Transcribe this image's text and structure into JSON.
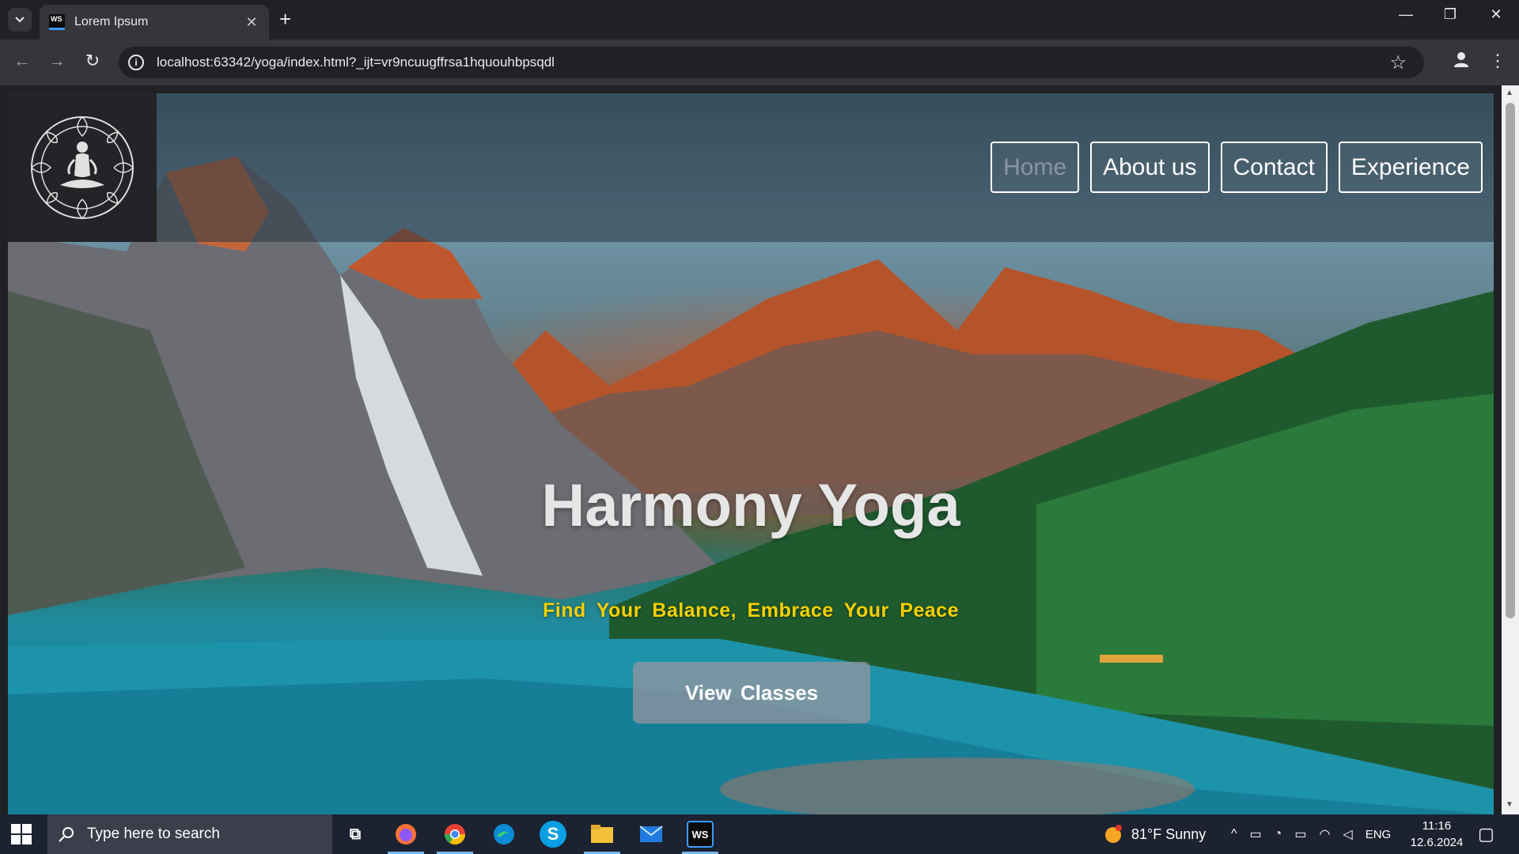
{
  "browser": {
    "tab_title": "Lorem Ipsum",
    "tab_favicon": "WS",
    "url": "localhost:63342/yoga/index.html?_ijt=vr9ncuugffrsa1hquouhbpsqdl",
    "icons": [
      "tab-search-icon",
      "close-icon",
      "new-tab-icon",
      "minimize-icon",
      "restore-icon",
      "window-close-icon",
      "back-icon",
      "forward-icon",
      "reload-icon",
      "site-info-icon",
      "bookmark-star-icon",
      "profile-icon",
      "menu-icon"
    ]
  },
  "page": {
    "logo": "lotus-meditation-logo",
    "nav": [
      {
        "label": "Home",
        "active": true
      },
      {
        "label": "About us",
        "active": false
      },
      {
        "label": "Contact",
        "active": false
      },
      {
        "label": "Experience",
        "active": false
      }
    ],
    "hero": {
      "title": "Harmony Yoga",
      "tagline": "Find Your Balance, Embrace Your Peace",
      "cta_label": "View Classes"
    },
    "colors": {
      "tagline": "#f5d000",
      "nav_border": "#ffffff",
      "logo_bg": "#232428"
    }
  },
  "taskbar": {
    "search_placeholder": "Type here to search",
    "apps": [
      "firefox-icon",
      "chrome-icon",
      "edge-icon",
      "skype-icon",
      "file-explorer-icon",
      "mail-icon",
      "webstorm-icon"
    ],
    "weather": "81°F  Sunny",
    "language": "ENG",
    "time": "11:16",
    "date": "12.6.2024"
  }
}
